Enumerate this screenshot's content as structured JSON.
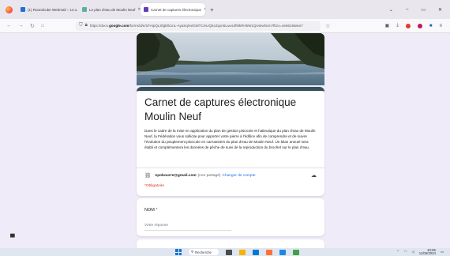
{
  "browser": {
    "tabs": [
      {
        "label": "(1) Roundcube Webmail :: 14.1.",
        "favicon_color": "#1f6fd6"
      },
      {
        "label": "Le plan d'eau de Moulin Neuf",
        "favicon_color": "#5bb0a0"
      },
      {
        "label": "Carnet de captures électronique",
        "favicon_color": "#673ab7",
        "active": true
      }
    ],
    "url_prefix": "https://docs.",
    "url_domain": "google.com",
    "url_rest": "/forms/d/e/1FAIpQLSfgEtk1nL-AyaSqHxlGMTCmUQ5cZqxn6LuwUIf5lkRHbW1Q/viewform?fbzx=4e5619alexi7",
    "new_tab_label": "+",
    "window_controls": [
      "⌄",
      "–",
      "▭",
      "✕"
    ]
  },
  "form": {
    "title": "Carnet de captures électronique Moulin Neuf",
    "description": "Dans le cadre de la mise en application du plan de gestion piscicole et halieutique du plan d'eau de Moulin Neuf, la Fédération vous sollicite pour apporter votre pierre à l'édifice afin de comprendre et de suivre l'évolution du peuplement piscicole en carnassiers du plan d'eau de Moulin Neuf. Un bilan annuel sera établi et complémentera les données de pêche de suivi de la reproduction du brochet sur le plan d'eau.",
    "account_email": "npobourre@gmail.com",
    "not_shared": "(non partagé)",
    "change_account": "Changer de compte",
    "required_note": "*Obligatoire",
    "question_label": "NOM",
    "question_required": "*",
    "answer_placeholder": "Votre réponse"
  },
  "taskbar": {
    "search_label": "Recherche",
    "time": "10:55",
    "date": "11/06/2024"
  },
  "colors": {
    "form_bg": "#f0ebf8",
    "header_accent": "#35505a",
    "required": "#d93025",
    "link": "#1a73e8"
  }
}
